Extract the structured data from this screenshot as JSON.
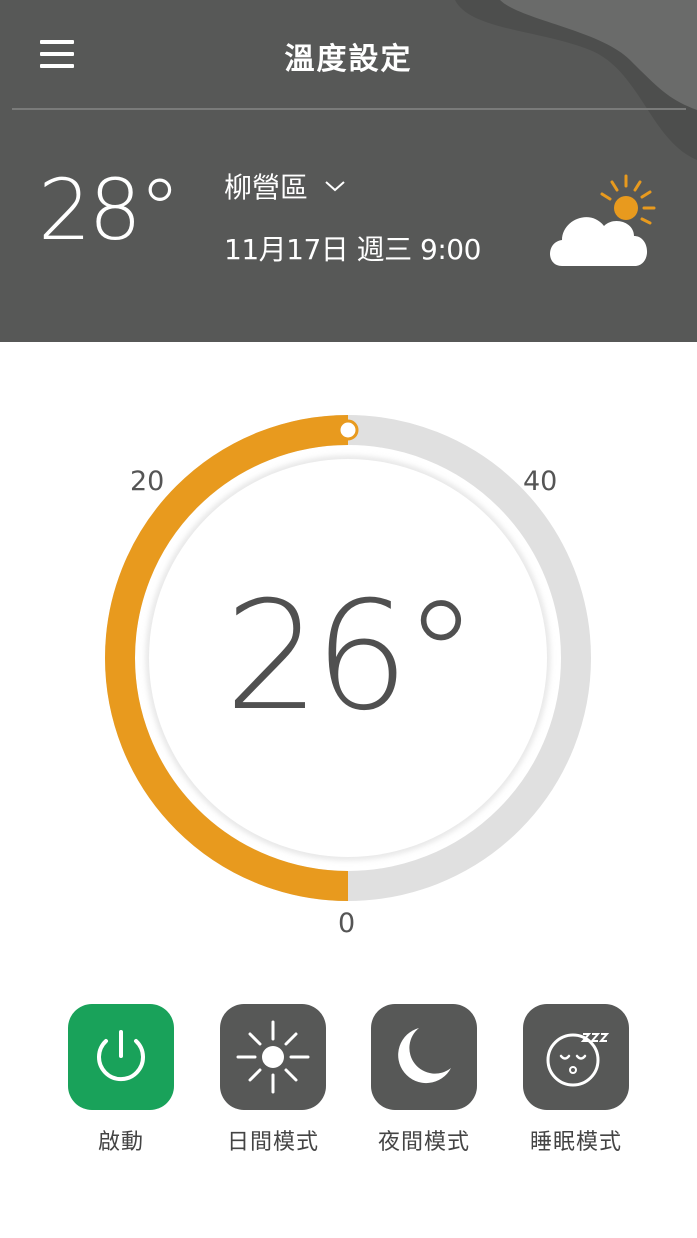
{
  "header": {
    "title": "溫度設定",
    "current_temp": "28°",
    "location": "柳營區",
    "datetime": "11月17日 週三 9:00",
    "weather_icon": "partly-sunny-icon"
  },
  "dial": {
    "set_temp": "26°",
    "min_label": "0",
    "mid_label": "20",
    "max_label": "40",
    "min_value": 0,
    "max_value": 40,
    "value": 20,
    "progress_color": "#e89a1e",
    "track_color": "#e0e0e0"
  },
  "modes": [
    {
      "label": "啟動",
      "icon": "power-icon",
      "active": true
    },
    {
      "label": "日間模式",
      "icon": "sun-icon",
      "active": false
    },
    {
      "label": "夜間模式",
      "icon": "moon-icon",
      "active": false
    },
    {
      "label": "睡眠模式",
      "icon": "sleep-face-icon",
      "active": false
    }
  ],
  "colors": {
    "header_bg": "#575857",
    "accent": "#e89a1e",
    "active_green": "#19a25a"
  }
}
